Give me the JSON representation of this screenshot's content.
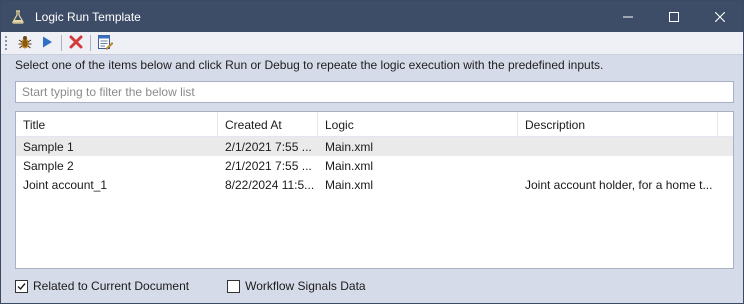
{
  "window": {
    "title": "Logic Run Template",
    "controls": {
      "minimize": "—",
      "maximize": "☐",
      "close": "✕"
    }
  },
  "toolbar": {
    "items": [
      {
        "icon": "debug-bug-icon"
      },
      {
        "icon": "run-play-icon"
      },
      {
        "icon": "delete-x-icon",
        "color": "#d33b3b"
      },
      {
        "icon": "edit-document-icon"
      }
    ]
  },
  "instruction": "Select one of the items below and click Run or Debug to repeate the logic execution with the predefined inputs.",
  "filter": {
    "placeholder": "Start typing to filter the below list",
    "value": ""
  },
  "list": {
    "columns": [
      "Title",
      "Created At",
      "Logic",
      "Description"
    ],
    "rows": [
      {
        "title": "Sample 1",
        "created_at": "2/1/2021 7:55 ...",
        "logic": "Main.xml",
        "description": ""
      },
      {
        "title": "Sample 2",
        "created_at": "2/1/2021 7:55 ...",
        "logic": "Main.xml",
        "description": ""
      },
      {
        "title": "Joint account_1",
        "created_at": "8/22/2024 11:5...",
        "logic": "Main.xml",
        "description": "Joint account holder, for a home t..."
      }
    ],
    "selected_index": 0
  },
  "footer": {
    "related_to_current_document": {
      "label": "Related to Current Document",
      "checked": true
    },
    "workflow_signals_data": {
      "label": "Workflow Signals Data",
      "checked": false
    }
  },
  "colors": {
    "titlebar": "#3d4d68",
    "background": "#d6dbe9",
    "accent_run": "#2f6fc8"
  }
}
